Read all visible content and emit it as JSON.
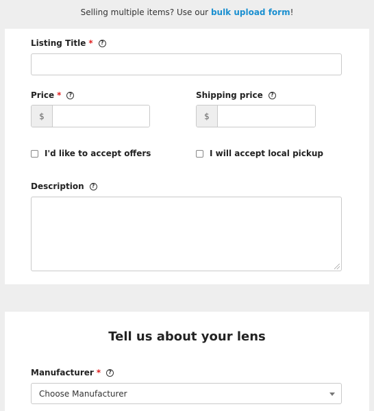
{
  "banner": {
    "text_before": "Selling multiple items? Use our ",
    "link_text": "bulk upload form",
    "text_after": "!"
  },
  "listing_title": {
    "label": "Listing Title",
    "required_mark": "*",
    "help_icon": "help-circle-icon",
    "value": ""
  },
  "price": {
    "label": "Price",
    "required_mark": "*",
    "help_icon": "help-circle-icon",
    "prefix": "$",
    "value": ""
  },
  "shipping_price": {
    "label": "Shipping price",
    "help_icon": "help-circle-icon",
    "prefix": "$",
    "value": ""
  },
  "accept_offers": {
    "label": "I'd like to accept offers",
    "checked": false
  },
  "local_pickup": {
    "label": "I will accept local pickup",
    "checked": false
  },
  "description": {
    "label": "Description",
    "help_icon": "help-circle-icon",
    "value": ""
  },
  "lens_section": {
    "title": "Tell us about your lens"
  },
  "manufacturer": {
    "label": "Manufacturer",
    "required_mark": "*",
    "help_icon": "help-circle-icon",
    "selected": "Choose Manufacturer"
  },
  "colors": {
    "link": "#1a8fd0",
    "required": "#e02020",
    "page_bg": "#eeeeee",
    "card_bg": "#ffffff",
    "border": "#c9c9c9"
  }
}
